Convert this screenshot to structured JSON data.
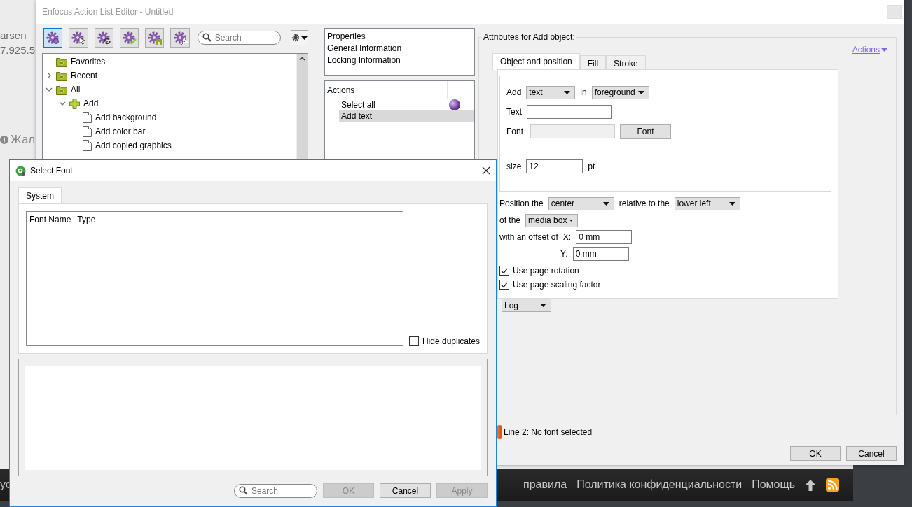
{
  "background_page": {
    "email_fragment": "arsen",
    "phone_fragment": "7.925.5",
    "report_fragment": "Жал",
    "footer_links": [
      "ус",
      "правила",
      "Политика конфиденциальности",
      "Помощь"
    ]
  },
  "editor": {
    "title": "Enfocus Action List Editor - Untitled",
    "toolbar": [
      {
        "kind": "gear",
        "selected": true
      },
      {
        "kind": "cursor",
        "selected": false
      },
      {
        "kind": "refresh",
        "selected": false
      },
      {
        "kind": "check",
        "selected": false
      },
      {
        "kind": "info",
        "selected": false
      },
      {
        "kind": "wrench",
        "selected": false
      }
    ],
    "search": {
      "placeholder": "Search"
    },
    "tree": [
      {
        "label": "Favorites",
        "kind": "folder"
      },
      {
        "label": "Recent",
        "kind": "folder",
        "expanded": false
      },
      {
        "label": "All",
        "kind": "folder",
        "expanded": true,
        "children": [
          {
            "label": "Add",
            "kind": "category",
            "expanded": true,
            "children": [
              {
                "label": "Add background",
                "kind": "action"
              },
              {
                "label": "Add color bar",
                "kind": "action"
              },
              {
                "label": "Add copied graphics",
                "kind": "action"
              }
            ]
          }
        ]
      }
    ],
    "properties": {
      "header": "Properties",
      "items": [
        "General Information",
        "Locking Information"
      ]
    },
    "actions": {
      "header": "Actions",
      "items": [
        {
          "label": "Select all",
          "selected": false,
          "flagged": true
        },
        {
          "label": "Add text",
          "selected": true,
          "flagged": false
        }
      ]
    },
    "attributes": {
      "title": "Attributes for Add object:",
      "actions_link": "Actions",
      "tabs": [
        {
          "label": "Object and position",
          "selected": true
        },
        {
          "label": "Fill",
          "selected": false
        },
        {
          "label": "Stroke",
          "selected": false
        }
      ],
      "add": {
        "label": "Add",
        "value": "text",
        "connector": "in",
        "layer": "foreground"
      },
      "text": {
        "label": "Text"
      },
      "font": {
        "label": "Font",
        "button": "Font",
        "disabled": true
      },
      "size": {
        "label": "size",
        "value": "12",
        "unit": "pt"
      },
      "position": {
        "label": "Position the",
        "anchor": "center",
        "relative_label": "relative to the",
        "reference": "lower left",
        "of_label": "of the",
        "box": "media box",
        "offset_label": "with an offset of",
        "x_label": "X:",
        "x_value": "0 mm",
        "y_label": "Y:",
        "y_value": "0 mm"
      },
      "checkboxes": [
        {
          "label": "Use page rotation",
          "checked": true
        },
        {
          "label": "Use page scaling factor",
          "checked": true
        }
      ],
      "log": "Log"
    },
    "status": {
      "message": "Line 2: No font selected"
    },
    "buttons": [
      "OK",
      "Cancel"
    ]
  },
  "font_dialog": {
    "title": "Select Font",
    "tabs": [
      {
        "label": "System",
        "selected": true
      }
    ],
    "columns": [
      "Font Name",
      "Type"
    ],
    "hide_duplicates": {
      "label": "Hide duplicates",
      "checked": false
    },
    "search": {
      "placeholder": "Search"
    },
    "buttons": [
      {
        "label": "OK",
        "disabled": true
      },
      {
        "label": "Cancel",
        "disabled": false
      },
      {
        "label": "Apply",
        "disabled": true
      }
    ]
  }
}
